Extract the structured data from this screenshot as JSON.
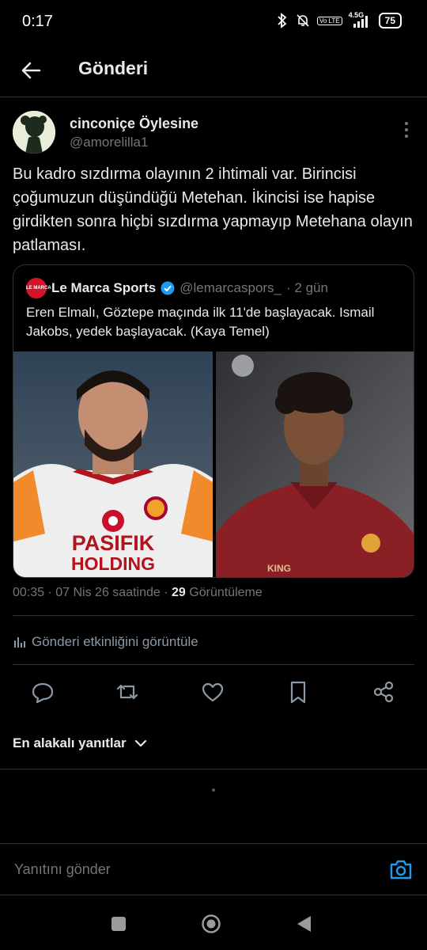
{
  "status_bar": {
    "time": "0:17",
    "network": "4.5G",
    "volte": "Vo LTE",
    "battery": "75",
    "icons": [
      "bluetooth-icon",
      "silent-bell-icon",
      "volte-icon",
      "signal-icon",
      "battery-icon"
    ]
  },
  "header": {
    "title": "Gönderi",
    "back_icon": "arrow-left-icon"
  },
  "post": {
    "author_name": "cinconiçe Öylesine",
    "author_handle": "@amorelilla1",
    "text": "Bu kadro sızdırma olayının 2 ihtimali var. Birincisi çoğumuzun düşündüğü Metehan. İkincisi ise hapise girdikten sonra hiçbi sızdırma yapmayıp Metehana olayın patlaması.",
    "quote": {
      "logo_text": "LE MARCA",
      "name": "Le Marca Sports",
      "verified": true,
      "handle": "@lemarcaspors_",
      "time": "· 2 gün",
      "text": "Eren Elmalı, Göztepe maçında ilk 11'de başlayacak. Ismail Jakobs, yedek başlayacak. (Kaya Temel)",
      "images": [
        {
          "jersey_text_1": "PASIFIK",
          "jersey_text_2": "HOLDING"
        },
        {
          "jersey_text": "KING"
        }
      ]
    },
    "timestamp": "00:35 · 07 Nis 26 saatinde ·",
    "views_count": "29",
    "views_label": "Görüntüleme",
    "activity_label": "Gönderi etkinliğini görüntüle"
  },
  "actions": [
    "reply-icon",
    "retweet-icon",
    "like-icon",
    "bookmark-icon",
    "share-icon"
  ],
  "replies": {
    "sort_label": "En alakalı yanıtlar"
  },
  "reply_box": {
    "placeholder": "Yanıtını gönder"
  },
  "colors": {
    "background": "#000000",
    "text": "#e7e9ea",
    "muted": "#71767b",
    "border": "#2f3336",
    "accent": "#1d9bf0"
  }
}
